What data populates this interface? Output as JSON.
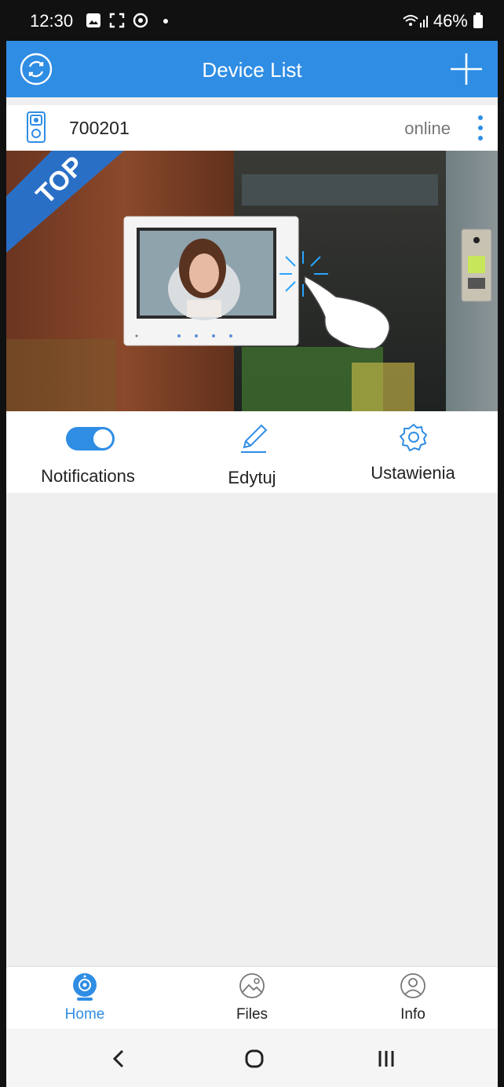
{
  "status_bar": {
    "time": "12:30",
    "battery": "46%"
  },
  "header": {
    "title": "Device List"
  },
  "device": {
    "name": "700201",
    "status": "online"
  },
  "banner": {
    "ribbon": "TOP"
  },
  "actions": {
    "notifications": {
      "label": "Notifications",
      "enabled": true
    },
    "edit": {
      "label": "Edytuj"
    },
    "settings": {
      "label": "Ustawienia"
    }
  },
  "bottom_nav": {
    "home": "Home",
    "files": "Files",
    "info": "Info",
    "active": "home"
  },
  "colors": {
    "accent": "#2f8de4",
    "background": "#efefef",
    "status_text": "#777777"
  }
}
